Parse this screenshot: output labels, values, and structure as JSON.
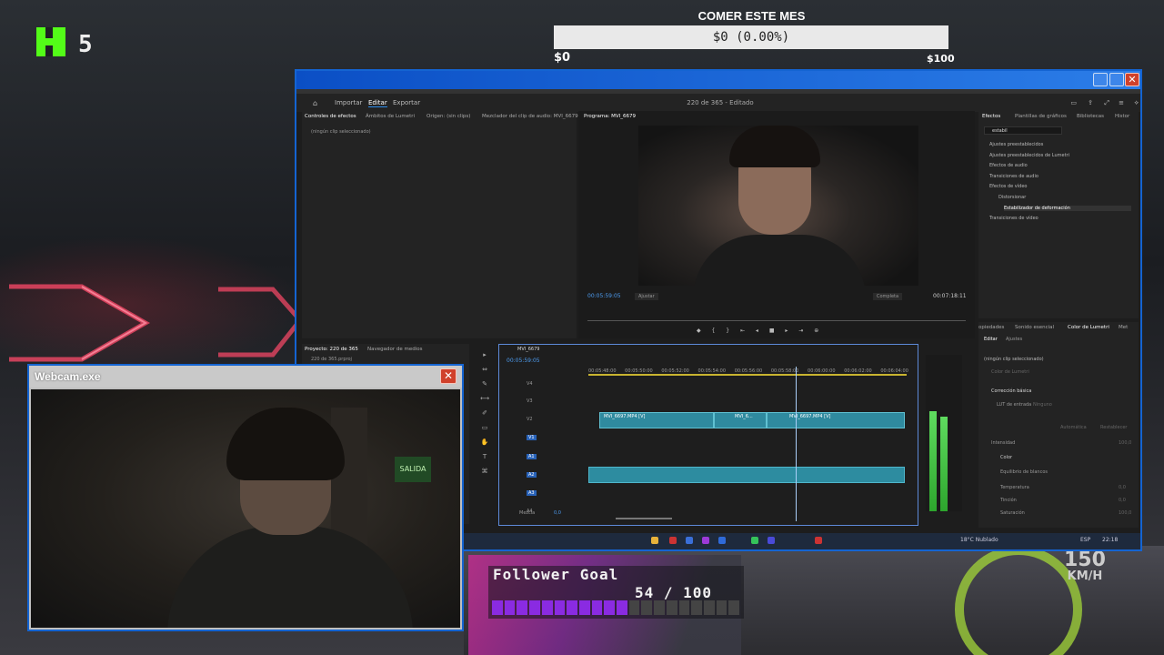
{
  "overlay": {
    "kick_count": "5",
    "donation_goal": {
      "title": "COMER ESTE MES",
      "current": "$0 (0.00%)",
      "min": "$0",
      "max": "$100"
    },
    "follower_goal": {
      "title": "Follower Goal",
      "count": "54 / 100",
      "progress": 0.54
    },
    "speedometer": {
      "value": "150",
      "unit": "KM/H"
    }
  },
  "premiere": {
    "nav": {
      "home": "home-icon",
      "import": "Importar",
      "edit": "Editar",
      "export": "Exportar"
    },
    "doc_title": "220 de 365 - Editado",
    "effects_controls": {
      "tabs": [
        "Controles de efectos",
        "Ámbitos de Lumetri",
        "Origen: (sin clips)",
        "Mezclador del clip de audio: MVI_6679"
      ],
      "empty": "(ningún clip seleccionado)"
    },
    "program": {
      "tab": "Programa: MVI_6679",
      "timecode": "00:05:59:05",
      "fit": "Ajustar",
      "quality": "Completa",
      "duration": "00:07:18:11"
    },
    "project": {
      "tabs": [
        "Proyecto: 220 de 365",
        "Navegador de medios"
      ],
      "file": "220 de 365.prproj"
    },
    "timeline": {
      "tab": "MVI_6679",
      "timecode": "00:05:59:05",
      "ruler": [
        "00:05:48:00",
        "00:05:50:00",
        "00:05:52:00",
        "00:05:54:00",
        "00:05:56:00",
        "00:05:58:00",
        "00:06:00:00",
        "00:06:02:00",
        "00:06:04:00"
      ],
      "tracks": [
        "V4",
        "V3",
        "V2",
        "V1",
        "A1",
        "A2",
        "A3",
        "A4"
      ],
      "clips": [
        "MVI_6697.MP4 [V]",
        "MVI_6...",
        "MVI_6697.MP4 [V]"
      ],
      "mix_label": "Mezcla",
      "mix_value": "0,0"
    },
    "effects": {
      "tabs": [
        "Efectos",
        "Plantillas de gráficos",
        "Bibliotecas",
        "Histor"
      ],
      "search": "estabil",
      "tree": [
        "Ajustes preestablecidos",
        "Ajustes preestablecidos de Lumetri",
        "Efectos de audio",
        "Transiciones de audio",
        "Efectos de vídeo",
        "Distorsionar",
        "Estabilizador de deformación",
        "Transiciones de vídeo"
      ]
    },
    "lumetri": {
      "tabs": [
        "opiedades",
        "Sonido esencial",
        "Color de Lumetri",
        "Met"
      ],
      "subtabs": [
        "Editar",
        "Ajustes"
      ],
      "clip": "(ningún clip seleccionado)",
      "preset": "Color de Lumetri",
      "section_basic": "Corrección básica",
      "lut_label": "LUT de entrada",
      "lut_value": "Ninguno",
      "auto": "Automática",
      "reset": "Restablecer",
      "intensity": "Intensidad",
      "intensity_value": "100,0",
      "color": "Color",
      "wb": "Equilibrio de blancos",
      "temperature": "Temperatura",
      "temperature_value": "0,0",
      "tint": "Tinción",
      "tint_value": "0,0",
      "saturation": "Saturación",
      "saturation_value": "100,0"
    },
    "taskbar": {
      "weather": "18°C Nublado",
      "lang": "ESP",
      "time": "22:18"
    }
  },
  "webcam": {
    "title": "Webcam.exe",
    "sign": "SALIDA"
  },
  "colors": {
    "kick_green": "#53fc18",
    "win_blue": "#1464d2",
    "follower_purple": "#8a2be2",
    "clip_teal": "#2f8a9f"
  }
}
